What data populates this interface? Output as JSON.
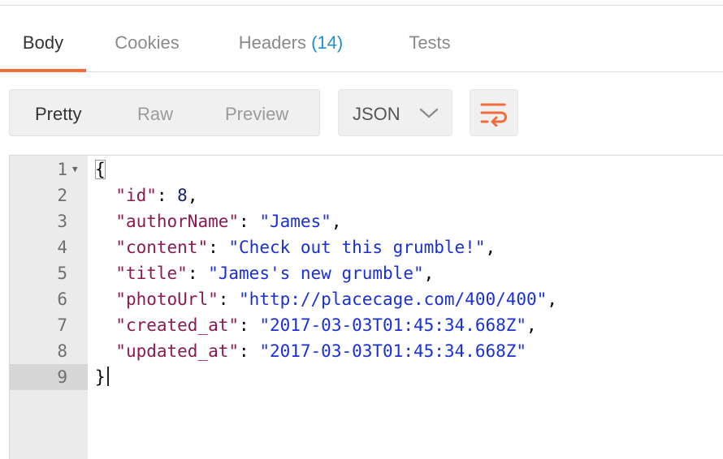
{
  "tabs": [
    {
      "label": "Body",
      "count": ""
    },
    {
      "label": "Cookies",
      "count": ""
    },
    {
      "label": "Headers",
      "count": "(14)"
    },
    {
      "label": "Tests",
      "count": ""
    }
  ],
  "active_tab": "Body",
  "view_modes": [
    "Pretty",
    "Raw",
    "Preview"
  ],
  "active_view": "Pretty",
  "format": {
    "selected": "JSON",
    "icon": "chevron-down-icon"
  },
  "wrap_button": {
    "icon": "wrap-lines-icon",
    "color": "#f26b3a"
  },
  "colors": {
    "accent": "#f26b3a",
    "key": "#8b1a4f",
    "string": "#1a2fd6",
    "number": "#0f1f7a",
    "count": "#1e8fd6"
  },
  "editor": {
    "current_line": 9,
    "lines": [
      {
        "n": "1",
        "open": "{"
      },
      {
        "n": "2",
        "key": "\"id\"",
        "num": "8",
        "trail": ","
      },
      {
        "n": "3",
        "key": "\"authorName\"",
        "str": "\"James\"",
        "trail": ","
      },
      {
        "n": "4",
        "key": "\"content\"",
        "str": "\"Check out this grumble!\"",
        "trail": ","
      },
      {
        "n": "5",
        "key": "\"title\"",
        "str": "\"James's new grumble\"",
        "trail": ","
      },
      {
        "n": "6",
        "key": "\"photoUrl\"",
        "str": "\"http://placecage.com/400/400\"",
        "trail": ","
      },
      {
        "n": "7",
        "key": "\"created_at\"",
        "str": "\"2017-03-03T01:45:34.668Z\"",
        "trail": ","
      },
      {
        "n": "8",
        "key": "\"updated_at\"",
        "str": "\"2017-03-03T01:45:34.668Z\"",
        "trail": ""
      },
      {
        "n": "9",
        "close": "}"
      }
    ]
  }
}
